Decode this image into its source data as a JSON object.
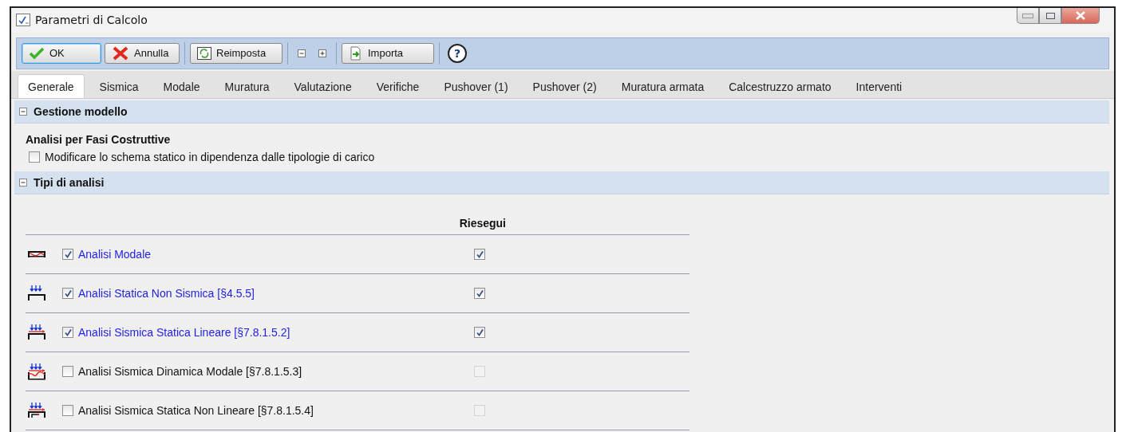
{
  "window": {
    "title": "Parametri di Calcolo"
  },
  "toolbar": [
    {
      "kind": "ok",
      "label": "OK",
      "focused": true
    },
    {
      "kind": "cancel",
      "label": "Annulla",
      "focused": false
    },
    {
      "kind": "separator"
    },
    {
      "kind": "reset",
      "label": "Reimposta",
      "focused": false
    },
    {
      "kind": "separator"
    },
    {
      "kind": "collapse"
    },
    {
      "kind": "expand"
    },
    {
      "kind": "separator"
    },
    {
      "kind": "import",
      "label": "Importa",
      "focused": false
    },
    {
      "kind": "separator"
    },
    {
      "kind": "help",
      "label": "?"
    }
  ],
  "tabs": [
    {
      "label": "Generale",
      "selected": true
    },
    {
      "label": "Sismica",
      "selected": false
    },
    {
      "label": "Modale",
      "selected": false
    },
    {
      "label": "Muratura",
      "selected": false
    },
    {
      "label": "Valutazione",
      "selected": false
    },
    {
      "label": "Verifiche",
      "selected": false
    },
    {
      "label": "Pushover (1)",
      "selected": false
    },
    {
      "label": "Pushover (2)",
      "selected": false
    },
    {
      "label": "Muratura armata",
      "selected": false
    },
    {
      "label": "Calcestruzzo armato",
      "selected": false
    },
    {
      "label": "Interventi",
      "selected": false
    }
  ],
  "sections": [
    {
      "title": "Gestione modello",
      "expanded": true,
      "kind": "options",
      "heading": "Analisi per Fasi Costruttive",
      "options": [
        {
          "label": "Modificare lo schema statico in dipendenza dalle tipologie di carico",
          "checked": false
        }
      ]
    },
    {
      "title": "Tipi di analisi",
      "expanded": true,
      "kind": "analyses",
      "column": "Riesegui",
      "rows": [
        {
          "kind": "modal",
          "label": "Analisi Modale",
          "checked": true,
          "rerun": {
            "checked": true,
            "disabled": false
          }
        },
        {
          "kind": "static",
          "label": "Analisi Statica Non Sismica [§4.5.5]",
          "checked": true,
          "rerun": {
            "checked": true,
            "disabled": false
          }
        },
        {
          "kind": "seismic-static",
          "label": "Analisi Sismica Statica Lineare [§7.8.1.5.2]",
          "checked": true,
          "rerun": {
            "checked": true,
            "disabled": false
          }
        },
        {
          "kind": "seismic-dynamic",
          "label": "Analisi Sismica Dinamica Modale [§7.8.1.5.3]",
          "checked": false,
          "rerun": {
            "checked": false,
            "disabled": true
          }
        },
        {
          "kind": "seismic-nonlinear",
          "label": "Analisi Sismica Statica Non Lineare  [§7.8.1.5.4]",
          "checked": false,
          "rerun": {
            "checked": false,
            "disabled": true
          }
        }
      ]
    }
  ]
}
